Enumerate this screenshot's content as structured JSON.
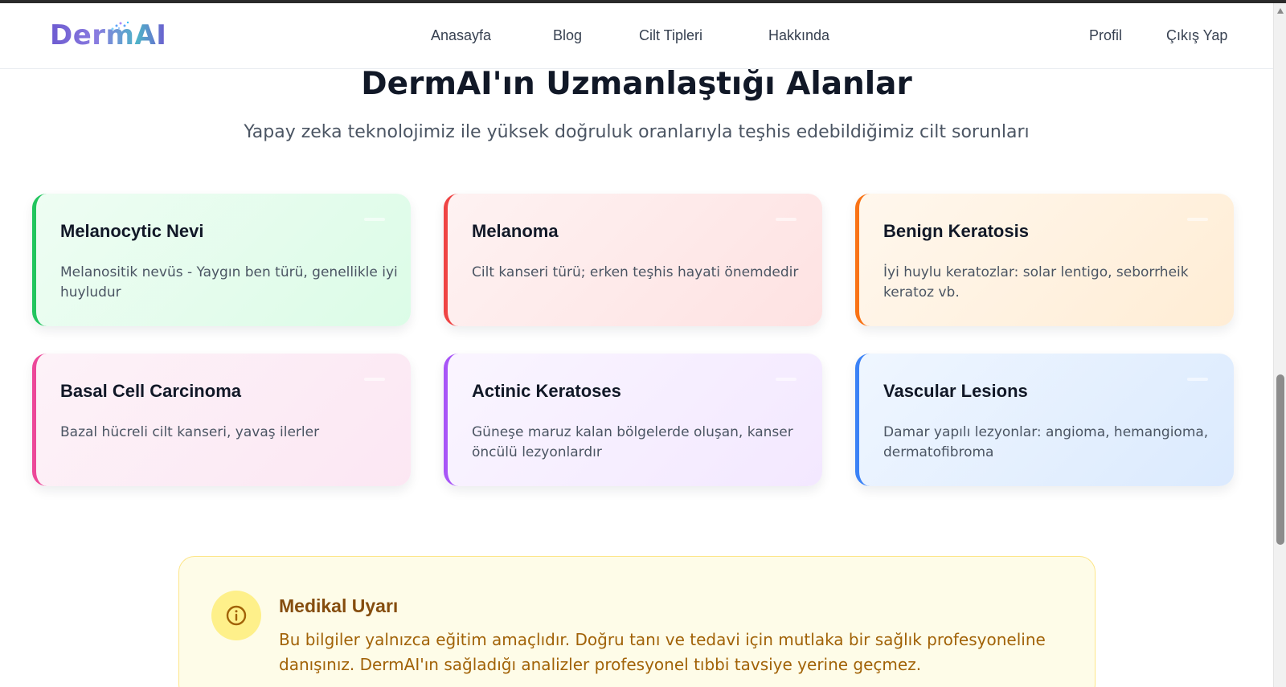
{
  "app": {
    "logo_text": "DermAI"
  },
  "nav": {
    "links": [
      {
        "label": "Anasayfa"
      },
      {
        "label": "Blog"
      },
      {
        "label": "Cilt Tipleri"
      },
      {
        "label": "Hakkında"
      }
    ],
    "right_links": [
      {
        "label": "Profil"
      },
      {
        "label": "Çıkış Yap"
      }
    ]
  },
  "section": {
    "title": "DermAI'ın Uzmanlaştığı Alanlar",
    "subtitle": "Yapay zeka teknolojimiz ile yüksek doğruluk oranlarıyla teşhis edebildiğimiz cilt sorunları"
  },
  "cards": [
    {
      "title": "Melanocytic Nevi",
      "description": "Melanositik nevüs - Yaygın ben türü, genellikle iyi huyludur",
      "accent": "#22c55e"
    },
    {
      "title": "Melanoma",
      "description": "Cilt kanseri türü; erken teşhis hayati önemdedir",
      "accent": "#ef4444"
    },
    {
      "title": "Benign Keratosis",
      "description": "İyi huylu keratozlar: solar lentigo, seborrheik keratoz vb.",
      "accent": "#f97316"
    },
    {
      "title": "Basal Cell Carcinoma",
      "description": "Bazal hücreli cilt kanseri, yavaş ilerler",
      "accent": "#ec4899"
    },
    {
      "title": "Actinic Keratoses",
      "description": "Güneşe maruz kalan bölgelerde oluşan, kanser öncülü lezyonlardır",
      "accent": "#a855f7"
    },
    {
      "title": "Vascular Lesions",
      "description": "Damar yapılı lezyonlar: angioma, hemangioma, dermatofibroma",
      "accent": "#3b82f6"
    }
  ],
  "warning": {
    "icon": "info-icon",
    "title": "Medikal Uyarı",
    "text": "Bu bilgiler yalnızca eğitim amaçlıdır. Doğru tanı ve tedavi için mutlaka bir sağlık profesyoneline danışınız. DermAI'ın sağladığı analizler profesyonel tıbbi tavsiye yerine geçmez."
  }
}
